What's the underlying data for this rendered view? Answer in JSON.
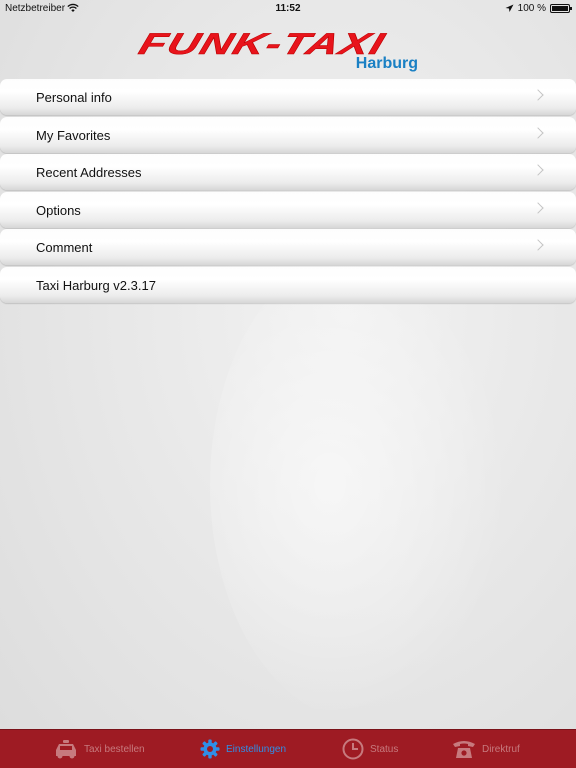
{
  "status_bar": {
    "carrier": "Netzbetreiber",
    "time": "11:52",
    "battery_text": "100 %",
    "battery_level": 1.0
  },
  "header": {
    "brand": "FUNK-TAXI",
    "subtitle": "Harburg"
  },
  "menu": {
    "items": [
      {
        "label": "Personal info",
        "has_chevron": true
      },
      {
        "label": "My Favorites",
        "has_chevron": true
      },
      {
        "label": "Recent Addresses",
        "has_chevron": true
      },
      {
        "label": "Options",
        "has_chevron": true
      },
      {
        "label": "Comment",
        "has_chevron": true
      },
      {
        "label": "Taxi Harburg v2.3.17",
        "has_chevron": false
      }
    ]
  },
  "tabbar": {
    "tabs": [
      {
        "label": "Taxi bestellen",
        "icon": "taxi-icon",
        "active": false
      },
      {
        "label": "Einstellungen",
        "icon": "gear-icon",
        "active": true
      },
      {
        "label": "Status",
        "icon": "clock-icon",
        "active": false
      },
      {
        "label": "Direktruf",
        "icon": "phone-icon",
        "active": false
      }
    ]
  },
  "colors": {
    "brand_red": "#e8141c",
    "brand_blue": "#1a80c4",
    "tabbar_bg": "#9e1b23",
    "tab_active": "#2f8fe8",
    "tab_inactive": "#c77a7e"
  }
}
